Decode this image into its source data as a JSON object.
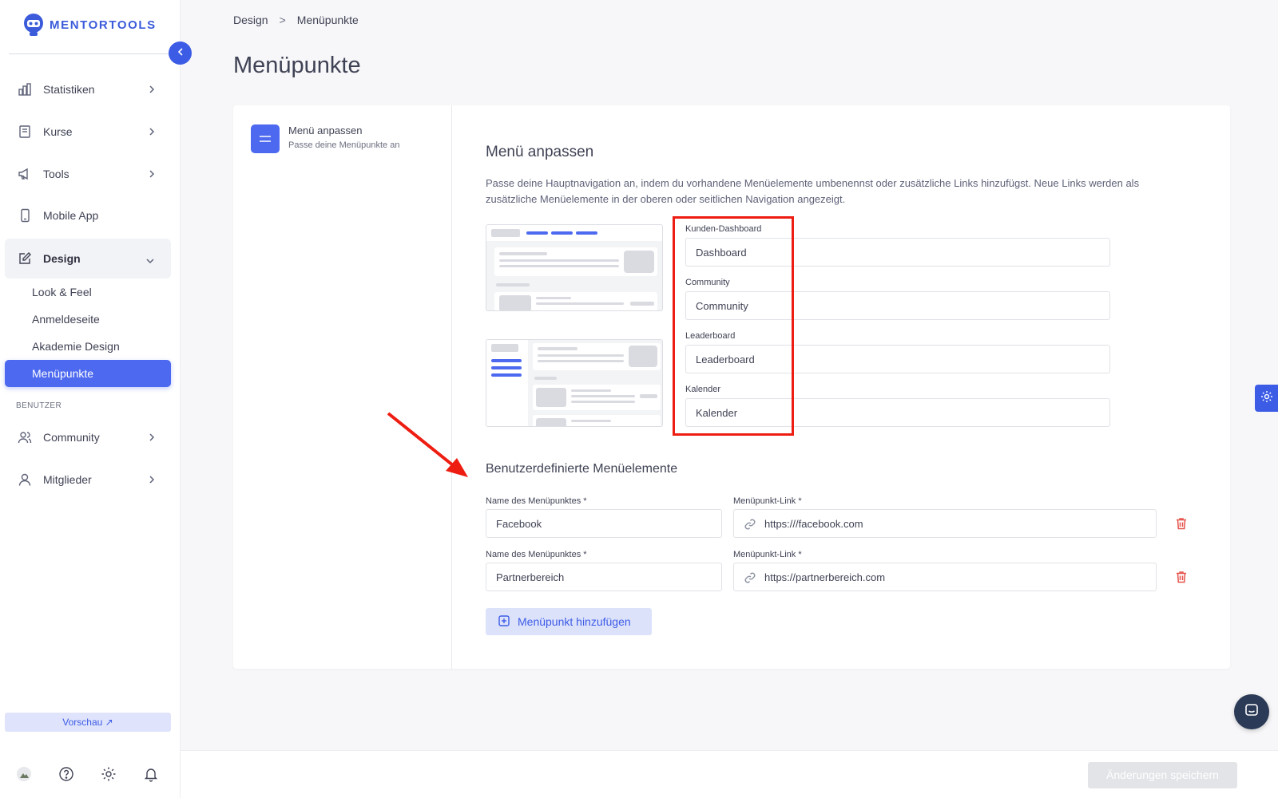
{
  "app": {
    "brand": "MENTORTOOLS"
  },
  "sidebar": {
    "items": [
      {
        "label": "Statistiken"
      },
      {
        "label": "Kurse"
      },
      {
        "label": "Tools"
      },
      {
        "label": "Mobile App"
      },
      {
        "label": "Design"
      }
    ],
    "design_sub": [
      "Look & Feel",
      "Anmeldeseite",
      "Akademie Design",
      "Menüpunkte"
    ],
    "section_label": "BENUTZER",
    "user_items": [
      {
        "label": "Community"
      },
      {
        "label": "Mitglieder"
      }
    ],
    "preview_label": "Vorschau ↗"
  },
  "breadcrumb": {
    "parent": "Design",
    "separator": ">",
    "current": "Menüpunkte"
  },
  "page": {
    "title": "Menüpunkte"
  },
  "steps": {
    "title": "Menü anpassen",
    "subtitle": "Passe deine Menüpunkte an"
  },
  "section": {
    "title": "Menü anpassen",
    "description": "Passe deine Hauptnavigation an, indem du vorhandene Menüelemente umbenennst oder zusätzliche Links hinzufügst. Neue Links werden als zusätzliche Menüelemente in der oberen oder seitlichen Navigation angezeigt."
  },
  "default_items": [
    {
      "label": "Kunden-Dashboard",
      "value": "Dashboard"
    },
    {
      "label": "Community",
      "value": "Community"
    },
    {
      "label": "Leaderboard",
      "value": "Leaderboard"
    },
    {
      "label": "Kalender",
      "value": "Kalender"
    }
  ],
  "custom": {
    "title": "Benutzerdefinierte Menüelemente",
    "name_label": "Name des Menüpunktes *",
    "link_label": "Menüpunkt-Link *",
    "rows": [
      {
        "name": "Facebook",
        "link": "https:///facebook.com"
      },
      {
        "name": "Partnerbereich",
        "link": "https://partnerbereich.com"
      }
    ],
    "add_label": "Menüpunkt hinzufügen"
  },
  "footer": {
    "save_label": "Änderungen speichern"
  },
  "colors": {
    "accent": "#4d69f0",
    "annotation": "#ee1d12",
    "danger": "#e5534b"
  }
}
